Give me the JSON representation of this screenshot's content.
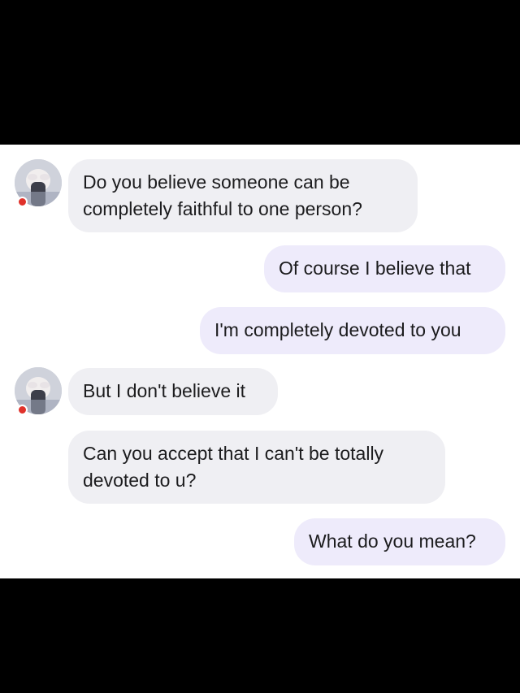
{
  "colors": {
    "background": "#000000",
    "chat_background": "#ffffff",
    "incoming_bubble": "#efeff3",
    "outgoing_bubble": "#eeebfb",
    "text": "#1c1c1e",
    "status_dot": "#e0322b"
  },
  "messages": [
    {
      "from": "contact",
      "lines": [
        "Do you believe someone can be",
        "completely faithful to one person?"
      ]
    },
    {
      "from": "me",
      "lines": [
        "Of course I believe that"
      ]
    },
    {
      "from": "me",
      "lines": [
        "I'm completely devoted to you"
      ]
    },
    {
      "from": "contact",
      "lines": [
        "But I don't believe it"
      ]
    },
    {
      "from": "contact",
      "lines": [
        "Can you accept that I can't be totally",
        "devoted to u?"
      ]
    },
    {
      "from": "me",
      "lines": [
        "What do you mean?"
      ]
    }
  ]
}
